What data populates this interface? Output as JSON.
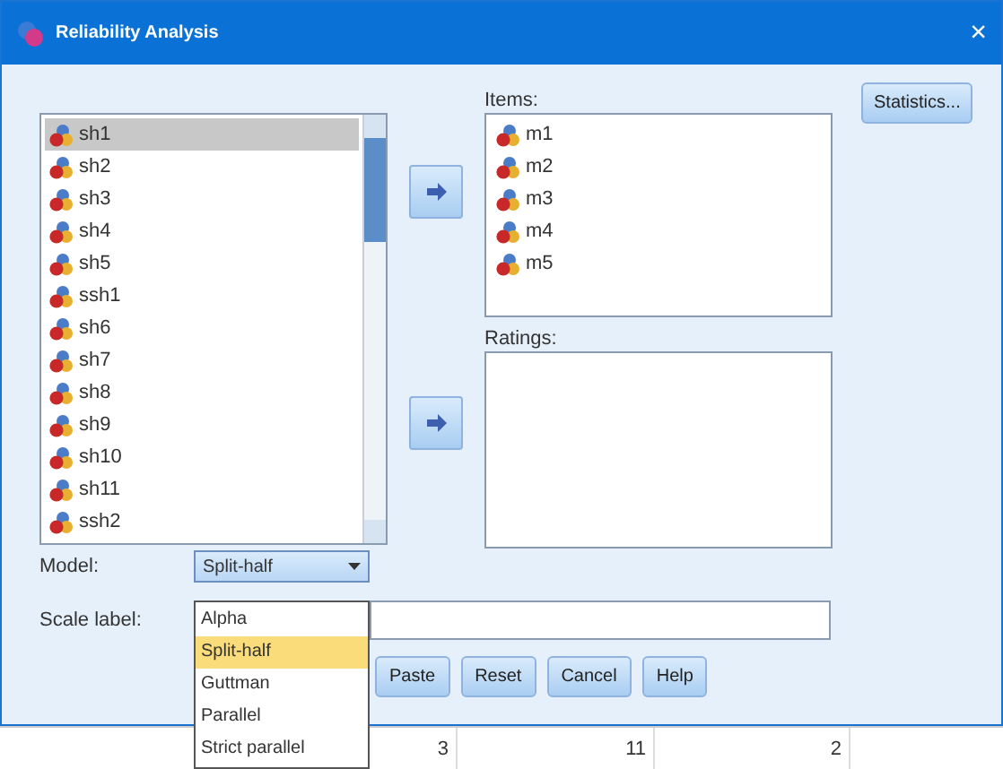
{
  "window": {
    "title": "Reliability Analysis",
    "close": "×"
  },
  "variables": [
    {
      "label": "sh1",
      "selected": true
    },
    {
      "label": "sh2",
      "selected": false
    },
    {
      "label": "sh3",
      "selected": false
    },
    {
      "label": "sh4",
      "selected": false
    },
    {
      "label": "sh5",
      "selected": false
    },
    {
      "label": "ssh1",
      "selected": false
    },
    {
      "label": "sh6",
      "selected": false
    },
    {
      "label": "sh7",
      "selected": false
    },
    {
      "label": "sh8",
      "selected": false
    },
    {
      "label": "sh9",
      "selected": false
    },
    {
      "label": "sh10",
      "selected": false
    },
    {
      "label": "sh11",
      "selected": false
    },
    {
      "label": "ssh2",
      "selected": false
    }
  ],
  "items": {
    "label": "Items:",
    "variables": [
      "m1",
      "m2",
      "m3",
      "m4",
      "m5"
    ]
  },
  "ratings": {
    "label": "Ratings:"
  },
  "statistics_button": "Statistics...",
  "model": {
    "label": "Model:",
    "value": "Split-half",
    "options": [
      {
        "label": "Alpha",
        "selected": false
      },
      {
        "label": "Split-half",
        "selected": true
      },
      {
        "label": "Guttman",
        "selected": false
      },
      {
        "label": "Parallel",
        "selected": false
      },
      {
        "label": "Strict parallel",
        "selected": false
      }
    ]
  },
  "scale_label": {
    "label": "Scale label:"
  },
  "buttons": [
    "Paste",
    "Reset",
    "Cancel",
    "Help"
  ],
  "data_row": [
    "3",
    "11",
    "2"
  ]
}
